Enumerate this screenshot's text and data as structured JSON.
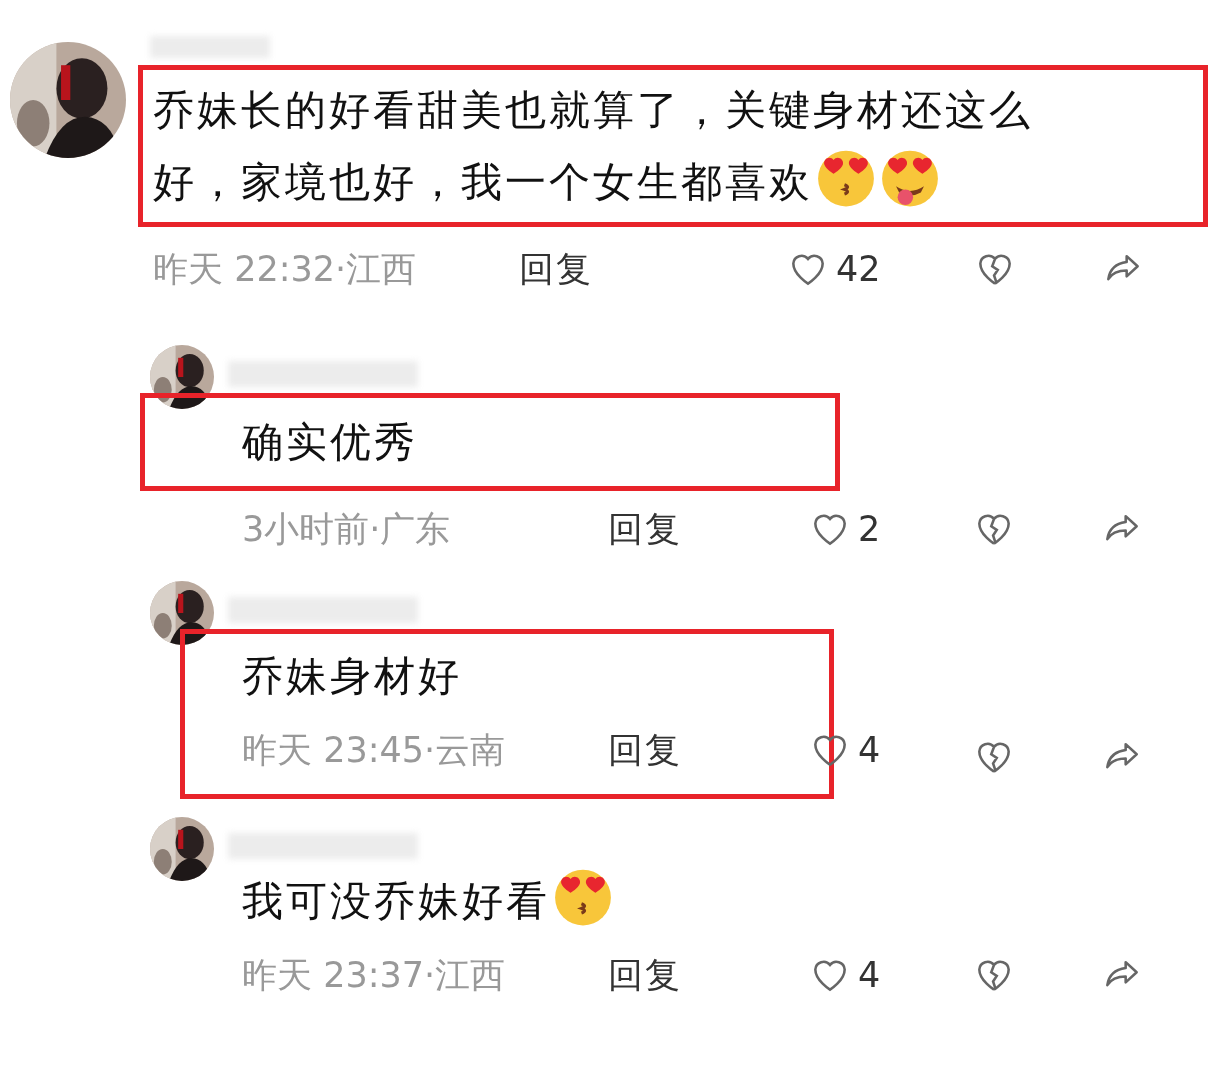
{
  "comments": [
    {
      "kind": "top",
      "text_highlighted": true,
      "meta_highlighted": false,
      "text": "乔妹长的好看甜美也就算了，关键身材还这么好，家境也好，我一个女生都喜欢",
      "emojis": [
        {
          "kind": "kiss"
        },
        {
          "kind": "tongue"
        }
      ],
      "time": "昨天 22:32·江西",
      "reply": "回复",
      "likes": "42"
    },
    {
      "kind": "reply",
      "text_highlighted": true,
      "meta_highlighted": false,
      "text": "确实优秀",
      "time": "3小时前·广东",
      "reply": "回复",
      "likes": "2"
    },
    {
      "kind": "reply",
      "text_highlighted": true,
      "meta_highlighted": true,
      "text": "乔妹身材好",
      "time": "昨天 23:45·云南",
      "reply": "回复",
      "likes": "4"
    },
    {
      "kind": "reply",
      "text_highlighted": false,
      "meta_highlighted": false,
      "text": "我可没乔妹好看",
      "emojis": [
        {
          "kind": "kiss"
        }
      ],
      "time": "昨天 23:37·江西",
      "reply": "回复",
      "likes": "4"
    }
  ]
}
